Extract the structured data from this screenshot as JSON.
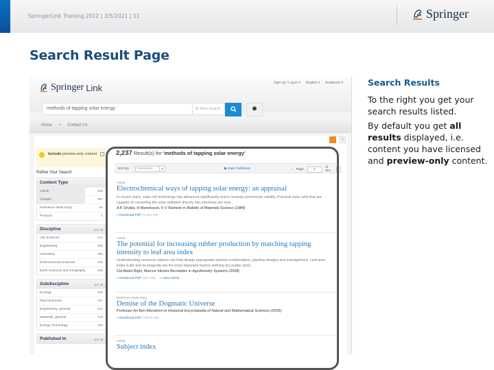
{
  "slide": {
    "footer": "SpringerLink Training 2012 | 3/5/2021 | 11",
    "publisher_logo": "Springer",
    "title": "Search Result Page"
  },
  "app": {
    "logo_main": "Springer",
    "logo_sub": "Link",
    "top_links": [
      "Sign up / Log in ▾",
      "English ▾",
      "Academic ▾"
    ],
    "search_value": "methods of tapping solar energy",
    "new_search_label": "New Search",
    "nav": [
      "Home",
      "•",
      "Contact Us"
    ]
  },
  "sidebar": {
    "preview_label_bold": "Include",
    "preview_label_rest": " preview-only content",
    "refine_label": "Refine Your Search",
    "facets": [
      {
        "title": "Content Type",
        "see_all": "",
        "items": [
          {
            "label": "Article",
            "count": "258"
          },
          {
            "label": "Chapter",
            "count": "997"
          },
          {
            "label": "Reference Work Entry",
            "count": "56"
          },
          {
            "label": "Protocol",
            "count": "1"
          }
        ]
      },
      {
        "title": "Discipline",
        "see_all": "see all",
        "items": [
          {
            "label": "Life Sciences",
            "count": "414"
          },
          {
            "label": "Engineering",
            "count": "405"
          },
          {
            "label": "Chemistry",
            "count": "385"
          },
          {
            "label": "Environmental Sciences",
            "count": "332"
          },
          {
            "label": "Earth Sciences and Geography",
            "count": "293"
          }
        ]
      },
      {
        "title": "Subdiscipline",
        "see_all": "see all",
        "items": [
          {
            "label": "Ecology",
            "count": "236"
          },
          {
            "label": "Plant Sciences",
            "count": "157"
          },
          {
            "label": "Engineering, general",
            "count": "121"
          },
          {
            "label": "Materials, general",
            "count": "119"
          },
          {
            "label": "Energy Technology",
            "count": "106"
          }
        ]
      },
      {
        "title": "Published In",
        "see_all": "see all",
        "items": []
      }
    ]
  },
  "results": {
    "count": "2,237",
    "label_mid": " Result(s) for ",
    "query": "'methods of tapping solar energy'",
    "sort_label": "Sort By",
    "sort_value": "Relevance",
    "date_published": "Date Published",
    "page_prev": "‹",
    "page_label": "Page",
    "page_value": "1",
    "page_of": "of 112",
    "page_next": "›",
    "items": [
      {
        "type": "Article",
        "title": "Electrochemical ways of tapping solar energy: an appraisal",
        "snippet": "In recent years, solar cell technology has advanced significantly and is nearing commercial viability. Practical solar cells that are capable of converting the solar radiation directly into electricity are now...",
        "authors": "A K Shukla, H Manoharan, K V Ramesh in ",
        "journal": "Bulletin of Materials Science (1984)",
        "download": "» Download PDF",
        "size": "(1,524 KB)",
        "view": ""
      },
      {
        "type": "Article",
        "title": "The potential for increasing rubber production by matching tapping intensity to leaf area index",
        "snippet": "Understanding resource capture can help design appropriate species combinations, planting designs and management. Leaf area index (LAI) and its longevity are the most important factors defining dry matter prod...",
        "authors": "Cid Abdul Righi, Marcos Silveira Bernardes in ",
        "journal": "Agroforestry Systems (2008)",
        "download": "» Download PDF",
        "size": "(347 KB)",
        "view": "» View Article"
      },
      {
        "type": "Reference Work Entry",
        "title": "Demise of the Dogmatic Universe",
        "snippet": "",
        "authors": "Professor Ari Ben-Menahem in ",
        "journal": "Historical Encyclopedia of Natural and Mathematical Sciences (2009)",
        "download": "» Download PDF",
        "size": "(23879 KB)",
        "view": ""
      },
      {
        "type": "Article",
        "title": "Subject index",
        "snippet": "",
        "authors": "",
        "journal": "",
        "download": "",
        "size": "",
        "view": ""
      }
    ]
  },
  "explanation": {
    "heading": "Search Results",
    "para1": "To the right you get your search results listed.",
    "para2_a": "By default you get ",
    "para2_b": "all results",
    "para2_c": " displayed, i.e. content you have licensed and ",
    "para2_d": "preview-only",
    "para2_e": " content."
  },
  "colors": {
    "accent_blue": "#1a5a8a",
    "link_blue": "#2779b8",
    "rss_orange": "#f08a24",
    "preview_bg": "#fdf6d9"
  }
}
